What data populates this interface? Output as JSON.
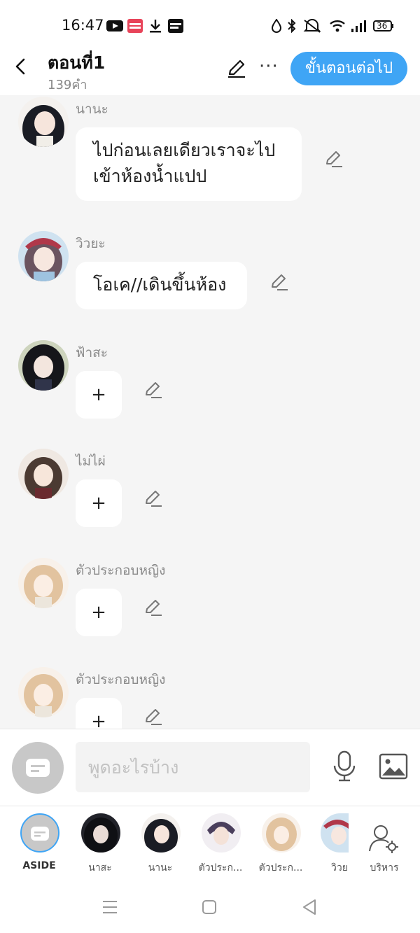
{
  "status_bar": {
    "time": "16:47",
    "icons": [
      "youtube-icon",
      "mangatoon-icon",
      "download-icon",
      "webtoon-icon",
      "drop-icon",
      "bluetooth-icon",
      "silent-icon",
      "wifi-icon",
      "signal-icon",
      "battery-icon"
    ],
    "battery": "36"
  },
  "header": {
    "title": "ตอนที่1",
    "subtitle": "139คำ",
    "next_label": "ขั้นตอนต่อไป",
    "more_label": "···"
  },
  "messages": [
    {
      "sender": "นานะ",
      "text_lines": [
        "ไปก่อนเลยเดียวเราจะไป",
        "เข้าห้องน้ำแปป"
      ]
    },
    {
      "sender": "วิวยะ",
      "text": "โอเค//เดินขึ้นห้อง"
    },
    {
      "sender": "ฟ้าสะ",
      "plus": "+"
    },
    {
      "sender": "ไม่ไผ่",
      "plus": "+"
    },
    {
      "sender": "ตัวประกอบหญิง",
      "plus": "+"
    },
    {
      "sender": "ตัวประกอบหญิง",
      "plus": "+"
    }
  ],
  "composer": {
    "placeholder": "พูดอะไรบ้าง"
  },
  "cast": [
    {
      "label": "ASIDE"
    },
    {
      "label": "นาสะ"
    },
    {
      "label": "นานะ"
    },
    {
      "label": "ตัวประก..."
    },
    {
      "label": "ตัวประก..."
    },
    {
      "label": "วิวย"
    },
    {
      "label": "บริหาร"
    }
  ],
  "colors": {
    "accent": "#3fa5f5",
    "background": "#f5f5f5",
    "bubble": "#ffffff"
  }
}
